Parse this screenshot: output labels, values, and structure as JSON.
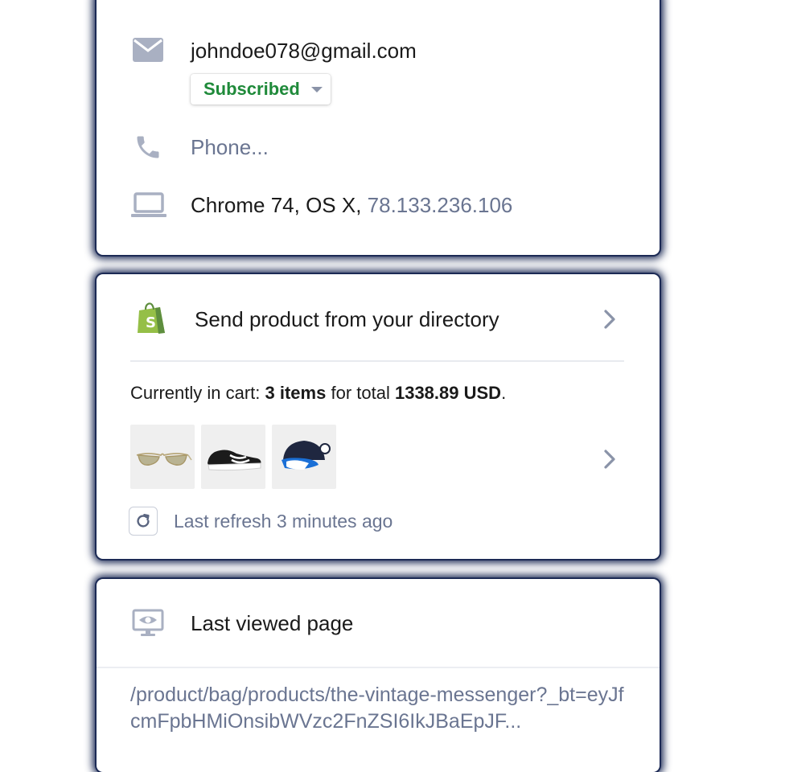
{
  "contact": {
    "email": "johndoe078@gmail.com",
    "subscription_status": "Subscribed",
    "phone_placeholder": "Phone...",
    "device_prefix": "Chrome 74, OS X,",
    "ip_address": "78.133.236.106"
  },
  "shop": {
    "title": "Send product from your directory",
    "cart_prefix": "Currently in cart:",
    "cart_items": "3 items",
    "cart_middle": "for total",
    "cart_total": "1338.89 USD",
    "cart_suffix": ".",
    "products": [
      "sunglasses",
      "running-shoe",
      "cap"
    ],
    "refresh_text": "Last refresh 3 minutes ago"
  },
  "last_viewed": {
    "title": "Last viewed page",
    "url": "/product/bag/products/the-vintage-messenger?_bt=eyJfcmFpbHMiOnsibWVzc2FnZSI6IkJBaEpJF..."
  },
  "colors": {
    "shopify_green": "#95bf47",
    "subscribed_green": "#1f8a3a",
    "muted_text": "#6a7591",
    "icon_gray": "#a9b0c2"
  }
}
